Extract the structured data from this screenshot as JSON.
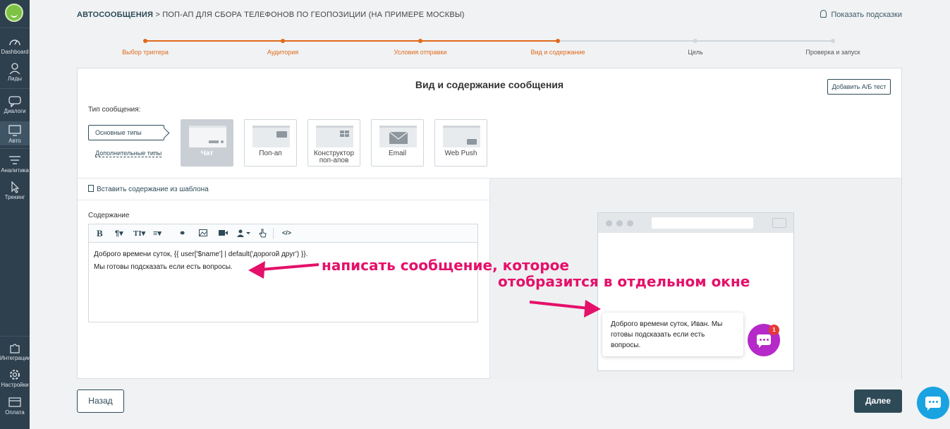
{
  "sidebar": {
    "items": [
      {
        "label": "Dashboard",
        "icon": "gauge-icon"
      },
      {
        "label": "Лиды",
        "icon": "people-icon"
      },
      {
        "label": "Диалоги",
        "icon": "chat-icon"
      },
      {
        "label": "Авто",
        "icon": "monitor-icon"
      },
      {
        "label": "Аналитика",
        "icon": "funnel-icon"
      },
      {
        "label": "Трекинг",
        "icon": "cursor-icon"
      },
      {
        "label": "Интеграции",
        "icon": "puzzle-icon"
      },
      {
        "label": "Настройки",
        "icon": "gear-icon"
      },
      {
        "label": "Оплата",
        "icon": "card-icon"
      }
    ]
  },
  "header": {
    "breadcrumb_root": "АВТОСООБЩЕНИЯ",
    "breadcrumb_rest": " > ПОП-АП ДЛЯ СБОРА ТЕЛЕФОНОВ ПО ГЕОПОЗИЦИИ (НА ПРИМЕРЕ МОСКВЫ)",
    "hints_label": "Показать подсказки"
  },
  "steps": [
    {
      "label": "Выбор триггера",
      "state": "done"
    },
    {
      "label": "Аудитория",
      "state": "done"
    },
    {
      "label": "Условия отправки",
      "state": "done"
    },
    {
      "label": "Вид и содержание",
      "state": "done"
    },
    {
      "label": "Цель",
      "state": "todo"
    },
    {
      "label": "Проверка и запуск",
      "state": "todo"
    }
  ],
  "card": {
    "title": "Вид и содержание сообщения",
    "ab_button": "Добавить А/Б тест",
    "type_label": "Тип сообщения:",
    "type_main": "Основные типы",
    "type_extra": "Дополнительные типы",
    "tiles": [
      "Чат",
      "Поп-ап",
      "Конструктор поп-апов",
      "Email",
      "Web Push"
    ],
    "template_link": "Вставить содержание из шаблона",
    "content_label": "Содержание",
    "editor_line1": "Доброго времени суток, {{ user['$name'] | default('дорогой друг') }}.",
    "editor_line2": "Мы готовы подсказать если есть вопросы."
  },
  "preview": {
    "bubble_text": "Доброго времени суток, Иван. Мы готовы подсказать если есть вопросы.",
    "badge_count": "1"
  },
  "annotations": {
    "note1": "написать сообщение, которое",
    "note2": "отобразится в отдельном окне"
  },
  "footer": {
    "back": "Назад",
    "next": "Далее"
  },
  "colors": {
    "sidebar": "#2e3f4d",
    "accent_orange": "#e06a1b",
    "annotation": "#e5106a",
    "chat_button": "#b629c9",
    "support": "#1aa3e0"
  }
}
